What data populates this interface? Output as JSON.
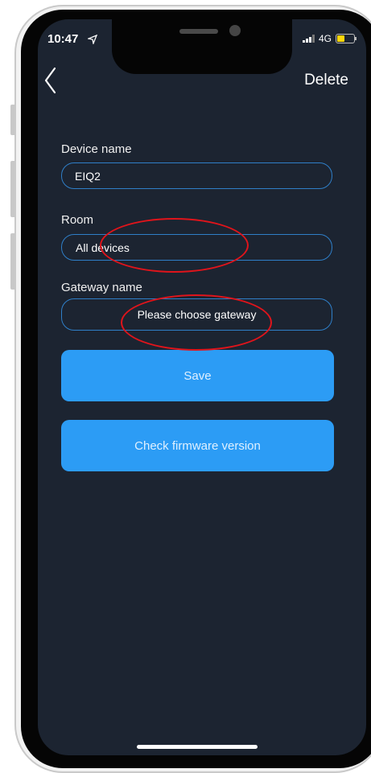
{
  "status_bar": {
    "time": "10:47",
    "network": "4G",
    "battery_level": 0.5
  },
  "header": {
    "delete_label": "Delete"
  },
  "form": {
    "device_name_label": "Device name",
    "device_name_value": "EIQ2",
    "room_label": "Room",
    "room_value": "All devices",
    "gateway_label": "Gateway name",
    "gateway_placeholder": "Please choose gateway"
  },
  "buttons": {
    "save_label": "Save",
    "firmware_label": "Check firmware version"
  },
  "colors": {
    "screen_background": "#1c2431",
    "field_border": "#2f7fc8",
    "button_background": "#2c9cf5",
    "annotation_red": "#e0141b"
  }
}
